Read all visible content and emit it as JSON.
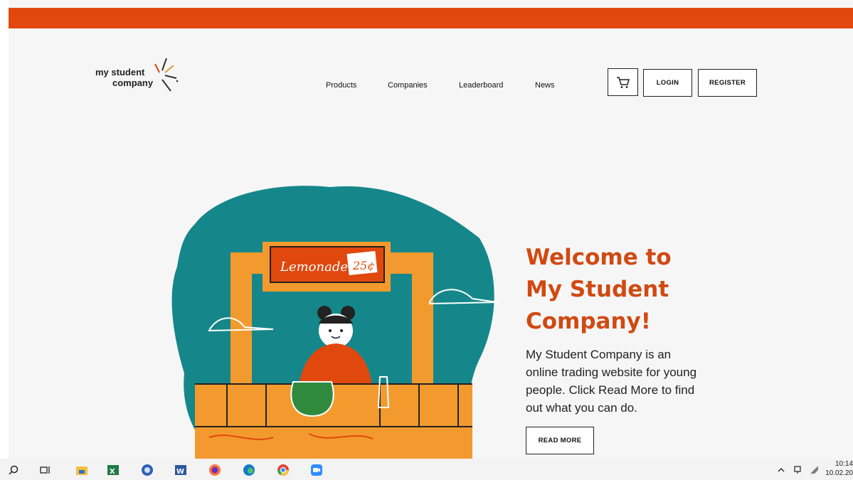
{
  "brand": {
    "line1": "my student",
    "line2": "company"
  },
  "nav": {
    "items": [
      {
        "label": "Products"
      },
      {
        "label": "Companies"
      },
      {
        "label": "Leaderboard"
      },
      {
        "label": "News"
      }
    ]
  },
  "header": {
    "login_label": "LOGIN",
    "register_label": "REGISTER",
    "cart_icon": "cart-icon"
  },
  "hero": {
    "title": "Welcome to My Student Company!",
    "description": "My Student Company is an online trading website for young people. Click Read More to find out what you can do.",
    "read_more_label": "READ MORE",
    "illustration": {
      "sign_text": "Lemonade",
      "price_text": "25¢"
    }
  },
  "taskbar": {
    "icons": [
      "search-icon",
      "task-view-icon",
      "file-explorer-icon",
      "excel-icon",
      "app-icon",
      "word-icon",
      "firefox-icon",
      "edge-icon",
      "chrome-icon",
      "zoom-icon"
    ],
    "time": "10:14",
    "date": "10.02.20"
  },
  "colors": {
    "accent": "#e0480e",
    "title": "#d04a12",
    "teal": "#15878a",
    "orange": "#f39a2e"
  }
}
